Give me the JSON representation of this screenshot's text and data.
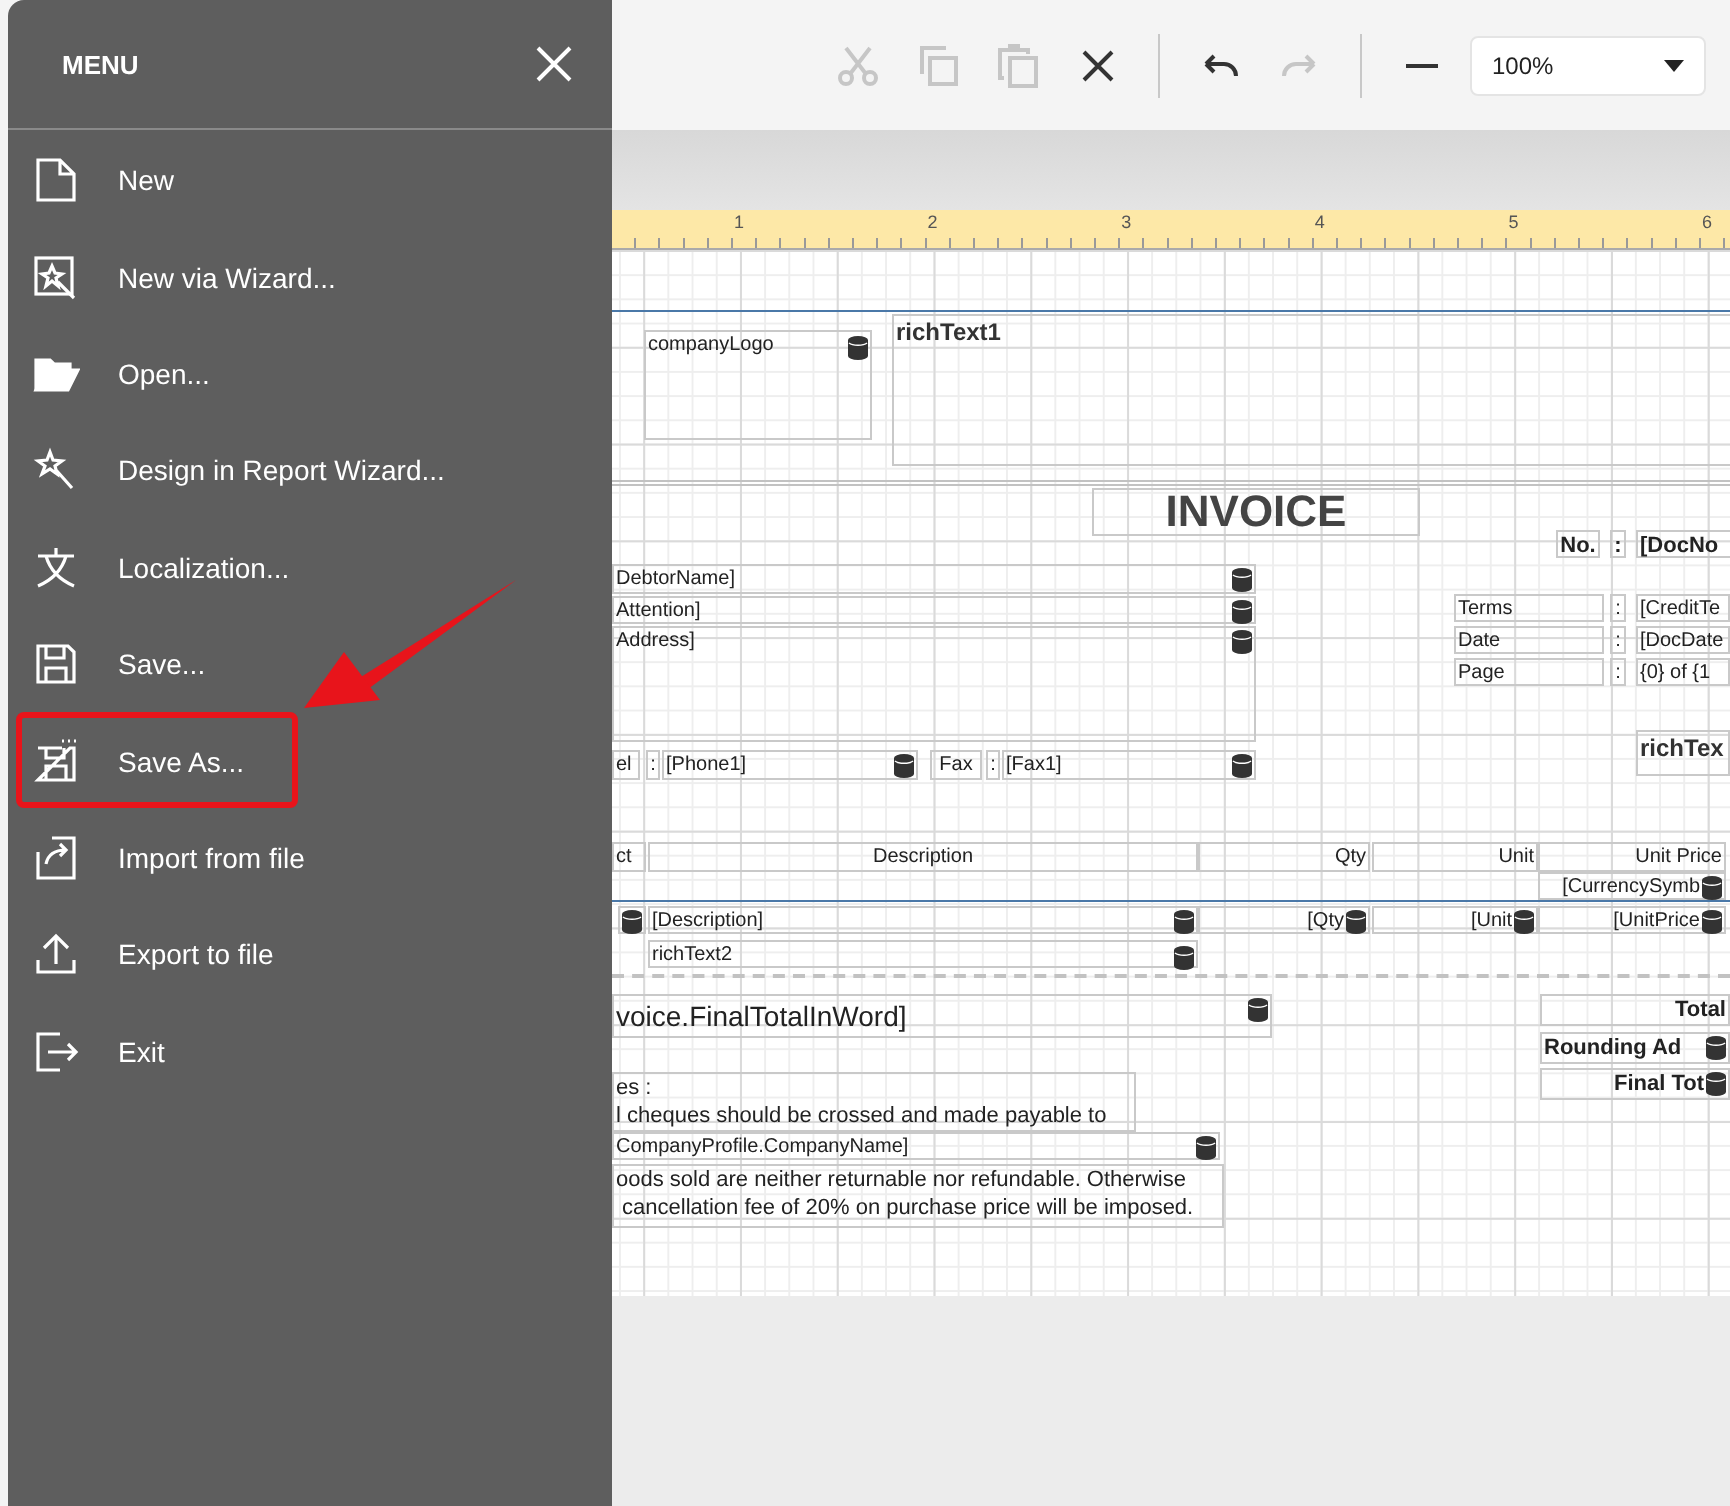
{
  "menu": {
    "title": "MENU",
    "items": [
      {
        "label": "New",
        "annotated": false
      },
      {
        "label": "New via Wizard...",
        "annotated": false
      },
      {
        "label": "Open...",
        "annotated": false
      },
      {
        "label": "Design in Report Wizard...",
        "annotated": false
      },
      {
        "label": "Localization...",
        "annotated": false
      },
      {
        "label": "Save...",
        "annotated": false
      },
      {
        "label": "Save As...",
        "annotated": true
      },
      {
        "label": "Import from file",
        "annotated": false
      },
      {
        "label": "Export to file",
        "annotated": false
      },
      {
        "label": "Exit",
        "annotated": false
      }
    ]
  },
  "toolbar": {
    "tools": [
      {
        "kind": "cut",
        "disabled": true
      },
      {
        "kind": "copy",
        "disabled": true
      },
      {
        "kind": "paste",
        "disabled": true
      },
      {
        "kind": "delete",
        "disabled": false
      },
      {
        "kind": "separator"
      },
      {
        "kind": "undo",
        "disabled": false
      },
      {
        "kind": "redo",
        "disabled": true
      },
      {
        "kind": "separator"
      },
      {
        "kind": "zoomout",
        "disabled": false
      }
    ],
    "zoom": "100%"
  },
  "report_canvas": {
    "ruler": [
      "1",
      "2",
      "3",
      "4",
      "5",
      "6"
    ],
    "controls": [
      {
        "kind": "small",
        "text": "companyLogo",
        "bound": true
      },
      {
        "kind": "rich",
        "text": "richText1",
        "bound": false
      },
      {
        "kind": "title",
        "text": "INVOICE",
        "bound": false
      },
      {
        "kind": "caption",
        "text": "No.",
        "bound": false
      },
      {
        "kind": "caption",
        "text": ":",
        "bound": false
      },
      {
        "kind": "caption",
        "text": "[DocNo",
        "bound": false
      },
      {
        "kind": "field",
        "text": "DebtorName]",
        "bound": true
      },
      {
        "kind": "field",
        "text": "Attention]",
        "bound": true
      },
      {
        "kind": "field",
        "text": "Address]",
        "bound": true
      },
      {
        "kind": "field",
        "text": "el",
        "bound": false
      },
      {
        "kind": "field",
        "text": ":",
        "bound": false
      },
      {
        "kind": "field",
        "text": "[Phone1]",
        "bound": true
      },
      {
        "kind": "field",
        "text": "Fax",
        "bound": false
      },
      {
        "kind": "field",
        "text": ":",
        "bound": false
      },
      {
        "kind": "field",
        "text": "[Fax1]",
        "bound": true
      },
      {
        "kind": "field",
        "text": "Terms",
        "bound": false
      },
      {
        "kind": "field",
        "text": ":",
        "bound": false
      },
      {
        "kind": "field",
        "text": "[CreditTe",
        "bound": false
      },
      {
        "kind": "field",
        "text": "Date",
        "bound": false
      },
      {
        "kind": "field",
        "text": ":",
        "bound": false
      },
      {
        "kind": "field",
        "text": "[DocDate",
        "bound": false
      },
      {
        "kind": "field",
        "text": "Page",
        "bound": false
      },
      {
        "kind": "field",
        "text": ":",
        "bound": false
      },
      {
        "kind": "field",
        "text": "{0} of {1",
        "bound": false
      },
      {
        "kind": "rich",
        "text": "richTex",
        "bound": false
      },
      {
        "kind": "field",
        "text": "ct",
        "bound": false
      },
      {
        "kind": "field",
        "text": "Description",
        "bound": false
      },
      {
        "kind": "field",
        "text": "Qty",
        "bound": false
      },
      {
        "kind": "field",
        "text": "Unit",
        "bound": false
      },
      {
        "kind": "field",
        "text": "Unit Price",
        "bound": false
      },
      {
        "kind": "field",
        "text": "[CurrencySymb",
        "bound": true
      },
      {
        "kind": "field",
        "bound": true
      },
      {
        "kind": "field",
        "text": "[Description]",
        "bound": true
      },
      {
        "kind": "field",
        "text": "[Qty",
        "bound": true
      },
      {
        "kind": "field",
        "text": "[Unit",
        "bound": true
      },
      {
        "kind": "field",
        "text": "[UnitPrice",
        "bound": true
      },
      {
        "kind": "small",
        "text": "richText2",
        "bound": true
      },
      {
        "kind": "large",
        "text": "voice.FinalTotalInWord]",
        "bound": true
      },
      {
        "kind": "caption",
        "text": "Total",
        "bound": false
      },
      {
        "kind": "caption",
        "text": "Rounding Ad",
        "bound": true
      },
      {
        "kind": "caption",
        "text": "Final Tot",
        "bound": true
      },
      {
        "kind": "note",
        "text": "es :\nl cheques should be crossed and made payable to",
        "bound": false
      },
      {
        "kind": "field",
        "text": "CompanyProfile.CompanyName]",
        "bound": true
      },
      {
        "kind": "note",
        "text": "oods sold are neither returnable nor refundable. Otherwise\n cancellation fee of 20% on purchase price will be imposed.",
        "bound": false
      }
    ]
  }
}
